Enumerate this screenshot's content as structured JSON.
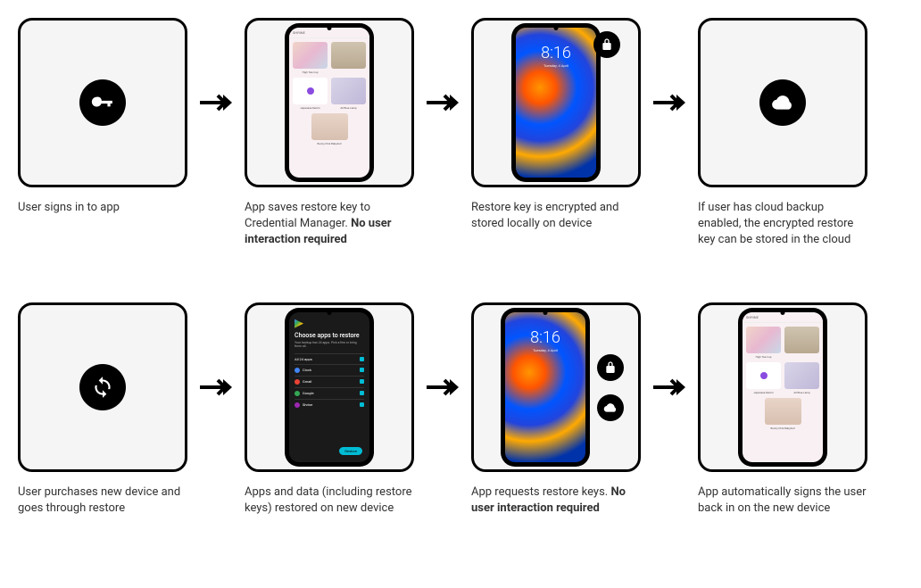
{
  "row1": {
    "step1": {
      "caption": "User signs in to app"
    },
    "step2": {
      "caption_pre": "App saves restore key to Credential Manager. ",
      "caption_bold": "No user interaction required"
    },
    "step3": {
      "caption": "Restore key is encrypted and stored locally on device",
      "time": "8:16",
      "date": "Tuesday, 4 April"
    },
    "step4": {
      "caption": "If user has cloud backup enabled, the encrypted restore key can be stored in the cloud"
    }
  },
  "row2": {
    "step1": {
      "caption": "User purchases new device and goes through restore"
    },
    "step2": {
      "caption": "Apps and data (including restore keys) restored on new device",
      "title": "Choose apps to restore",
      "subtitle": "Your backup has 24 apps. Pick a few or bring them all.",
      "all_label": "All 24 apps",
      "apps": [
        "Clock",
        "Gmail",
        "Google",
        "Shrine"
      ],
      "button": "Restore"
    },
    "step3": {
      "caption_pre": "App requests restore keys. ",
      "caption_bold": "No user interaction required",
      "time": "8:16",
      "date": "Tuesday, 4 April"
    },
    "step4": {
      "caption": "App automatically signs the user back in on the new device"
    }
  },
  "shop": {
    "brand": "SHRINE",
    "items": [
      "High Tea Cup",
      "",
      "Japanese Denim",
      "All Blue Lamp",
      "Bunny Pink Babydoll"
    ]
  }
}
